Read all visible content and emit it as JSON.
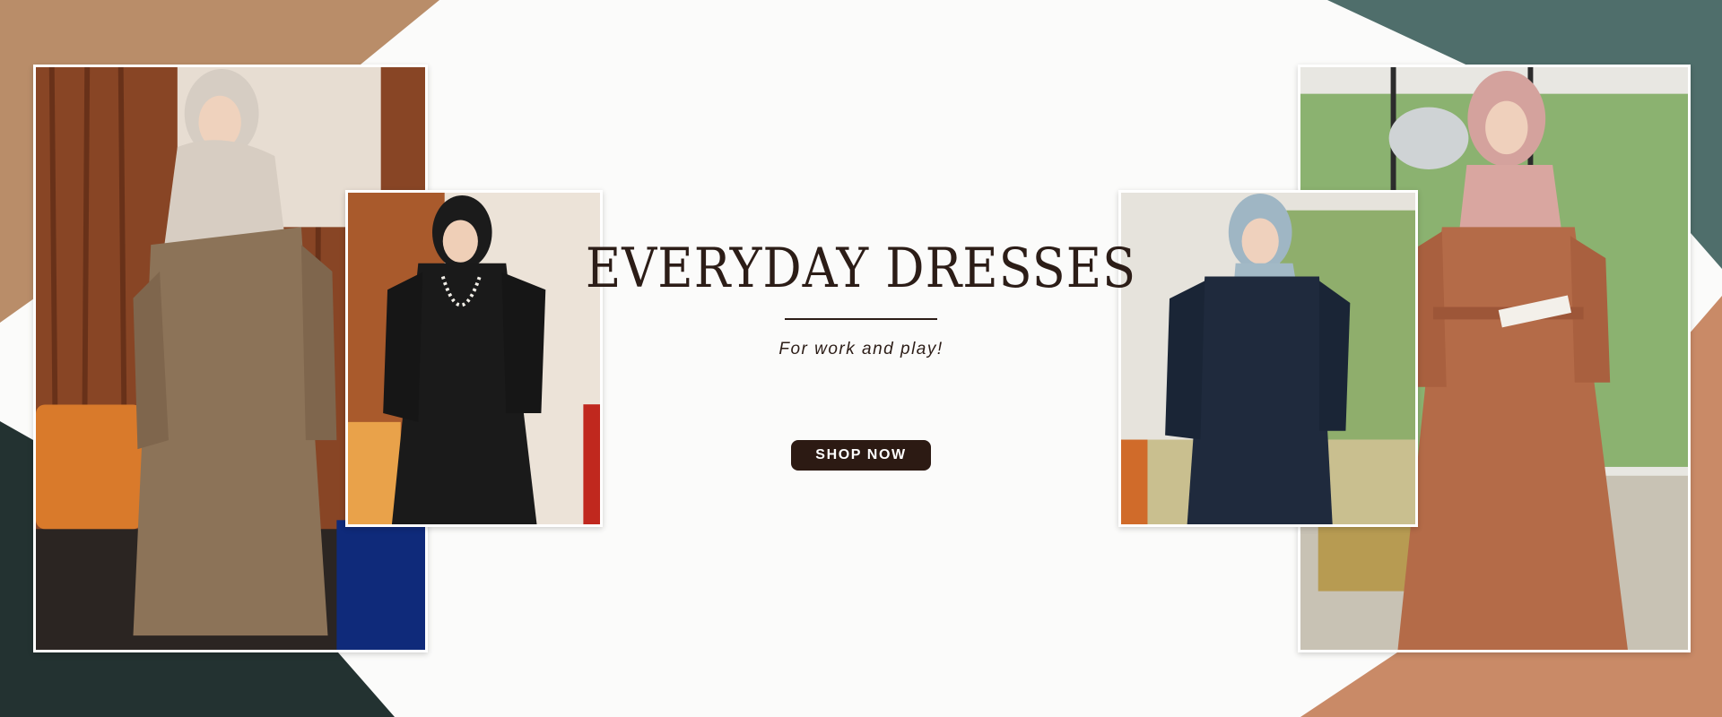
{
  "banner": {
    "headline": "EVERYDAY DRESSES",
    "subline": "For work and play!",
    "cta_label": "SHOP NOW"
  },
  "colors": {
    "accent_tan": "#b98d69",
    "accent_teal": "#4f6e6b",
    "accent_dark": "#233231",
    "accent_terracotta": "#c98a67",
    "button_bg": "#2c1a13",
    "text_dark": "#2c1d17"
  },
  "photos": [
    {
      "name": "model-brown-dress-photo"
    },
    {
      "name": "model-black-dress-photo"
    },
    {
      "name": "model-navy-dress-photo"
    },
    {
      "name": "model-terracotta-dress-photo"
    }
  ]
}
